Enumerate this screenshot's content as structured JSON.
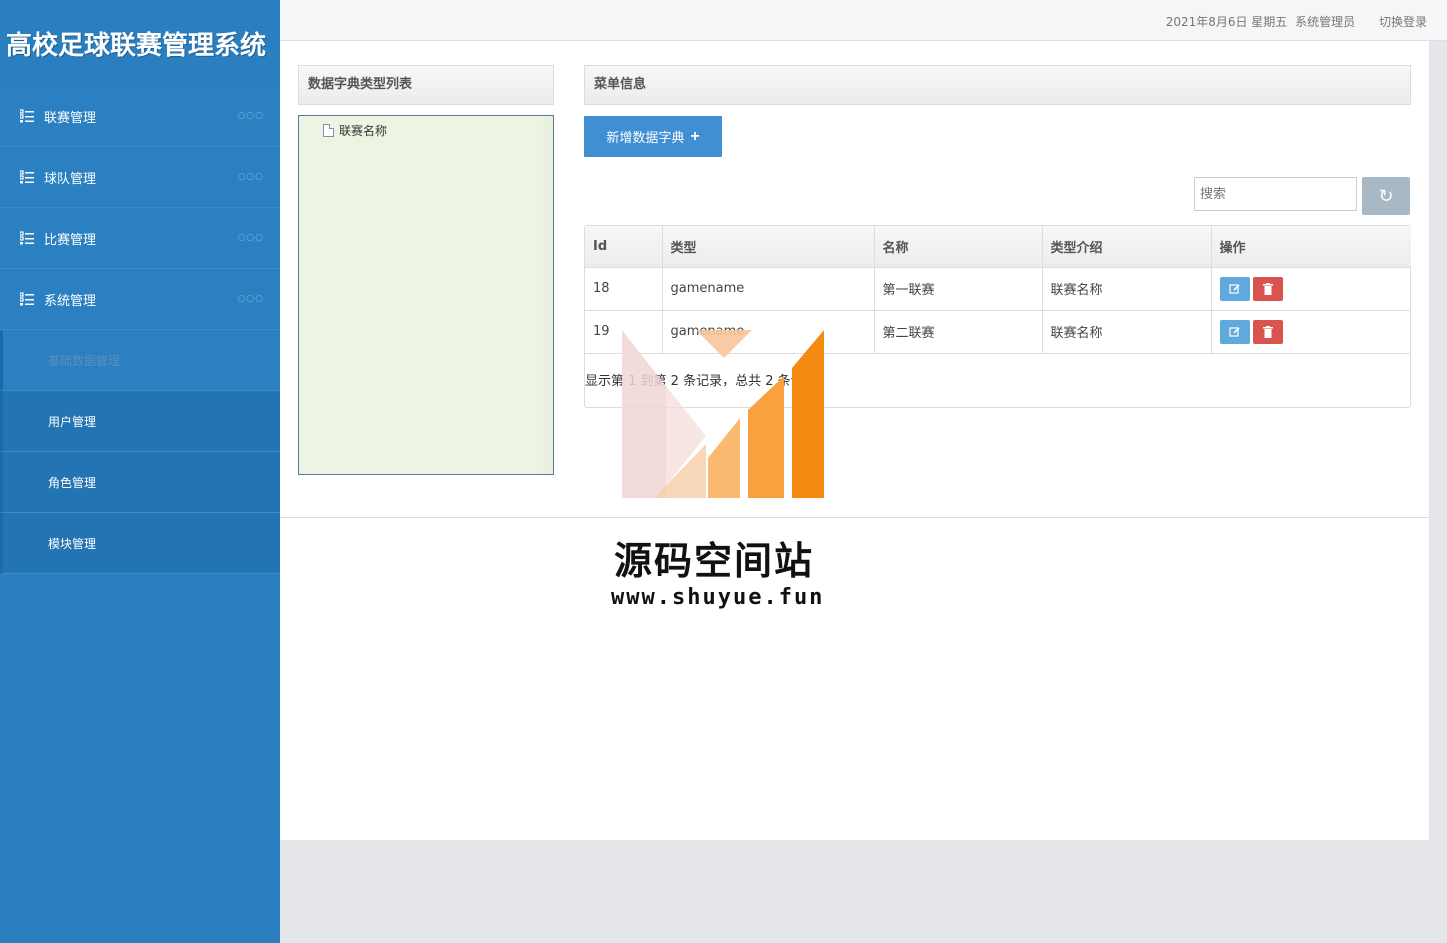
{
  "app": {
    "title": "高校足球联赛管理系统"
  },
  "topbar": {
    "date": "2021年8月6日 星期五",
    "user": "系统管理员",
    "switch_label": "切换登录"
  },
  "sidebar": {
    "menus": [
      {
        "label": "联赛管理",
        "dots": "○○○"
      },
      {
        "label": "球队管理",
        "dots": "○○○"
      },
      {
        "label": "比赛管理",
        "dots": "○○○"
      },
      {
        "label": "系统管理",
        "dots": "○○○"
      }
    ],
    "subs": [
      {
        "label": "基础数据管理"
      },
      {
        "label": "用户管理"
      },
      {
        "label": "角色管理"
      },
      {
        "label": "模块管理"
      }
    ]
  },
  "left_panel": {
    "title": "数据字典类型列表",
    "tree": [
      "联赛名称"
    ]
  },
  "right_panel": {
    "title": "菜单信息",
    "add_label": "新增数据字典",
    "add_icon": "+",
    "search_placeholder": "搜索",
    "refresh_icon": "↻"
  },
  "table": {
    "headers": [
      "Id",
      "类型",
      "名称",
      "类型介绍",
      "操作"
    ],
    "rows": [
      {
        "id": "18",
        "type": "gamename",
        "name": "第一联赛",
        "desc": "联赛名称"
      },
      {
        "id": "19",
        "type": "gamename",
        "name": "第二联赛",
        "desc": "联赛名称"
      }
    ],
    "pager": "显示第 1 到第 2 条记录，总共 2 条记录"
  },
  "watermark": {
    "title": "源码空间站",
    "url": "www.shuyue.fun"
  }
}
